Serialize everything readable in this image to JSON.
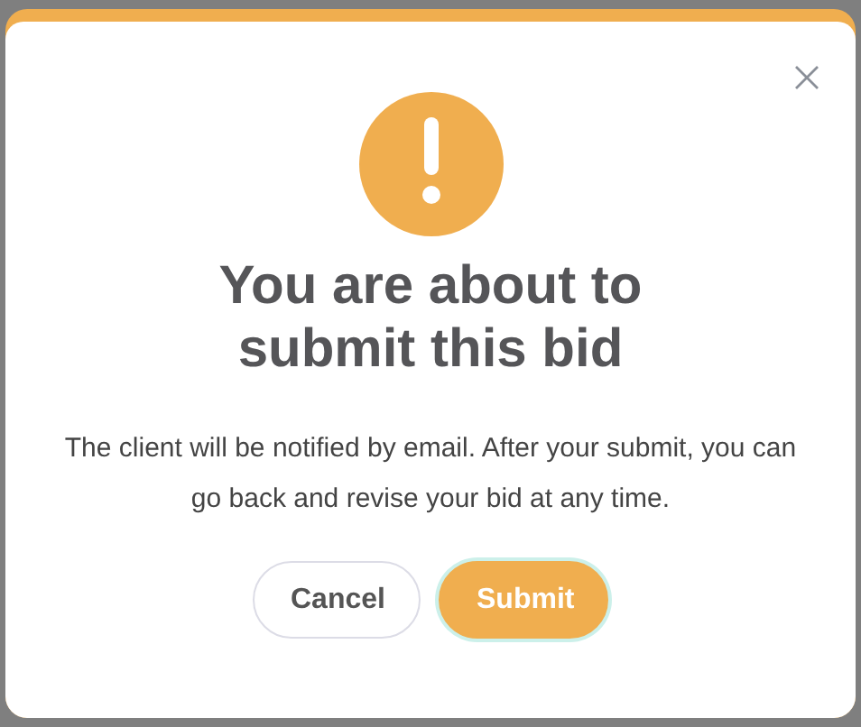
{
  "dialog": {
    "title": "You are about to submit this bid",
    "message": "The client will be notified by email. After your submit, you can go back and revise your bid at any time.",
    "buttons": [
      {
        "label": "Cancel",
        "kind": "secondary",
        "focused": false
      },
      {
        "label": "Submit",
        "kind": "primary",
        "focused": true
      }
    ]
  }
}
